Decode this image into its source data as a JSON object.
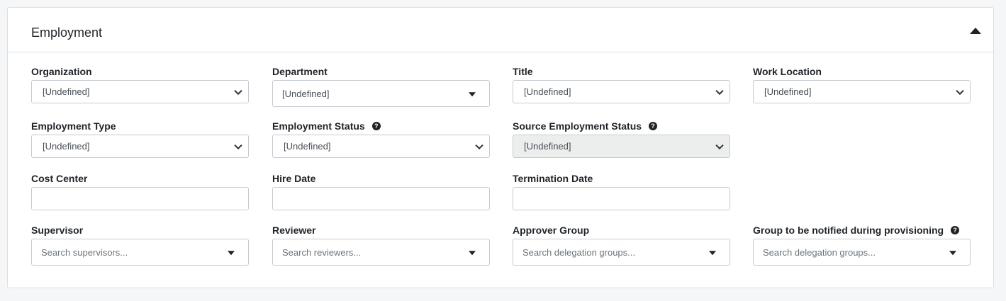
{
  "card": {
    "title": "Employment"
  },
  "fields": {
    "organization": {
      "label": "Organization",
      "value": "[Undefined]"
    },
    "department": {
      "label": "Department",
      "value": "[Undefined]"
    },
    "title": {
      "label": "Title",
      "value": "[Undefined]"
    },
    "work_location": {
      "label": "Work Location",
      "value": "[Undefined]"
    },
    "employment_type": {
      "label": "Employment Type",
      "value": "[Undefined]"
    },
    "employment_status": {
      "label": "Employment Status",
      "value": "[Undefined]"
    },
    "source_employment_status": {
      "label": "Source Employment Status",
      "value": "[Undefined]"
    },
    "cost_center": {
      "label": "Cost Center",
      "value": ""
    },
    "hire_date": {
      "label": "Hire Date",
      "value": ""
    },
    "termination_date": {
      "label": "Termination Date",
      "value": ""
    },
    "supervisor": {
      "label": "Supervisor",
      "placeholder": "Search supervisors..."
    },
    "reviewer": {
      "label": "Reviewer",
      "placeholder": "Search reviewers..."
    },
    "approver_group": {
      "label": "Approver Group",
      "placeholder": "Search delegation groups..."
    },
    "notify_group": {
      "label": "Group to be notified during provisioning",
      "placeholder": "Search delegation groups..."
    }
  },
  "icons": {
    "help": "?",
    "collapse": "caret-up-icon"
  }
}
